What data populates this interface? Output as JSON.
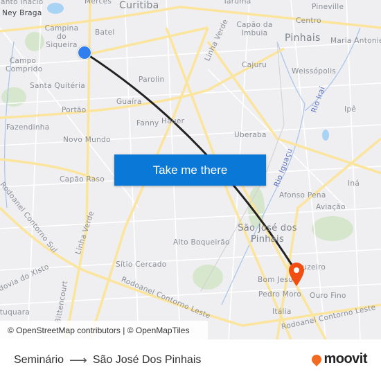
{
  "map": {
    "labels": {
      "santo_inacio": "Santo Inácio",
      "merces": "Mercês",
      "curitiba": "Curitiba",
      "taruma": "Tarumã",
      "pineville": "Pineville",
      "ney_braga": "Ney Braga",
      "campina_do_siqueira": "Campina do Siqueira",
      "batel": "Batel",
      "linha_verde_north": "Linha Verde",
      "capao_da_imbuia": "Capão da Imbuia",
      "centro": "Centro",
      "pinhais": "Pinhais",
      "maria_antonieta": "Maria Antonie",
      "campo_comprido": "Campo Comprido",
      "parolin": "Parolin",
      "cajuru": "Cajuru",
      "weissopolis": "Weissópolis",
      "santa_quiteria": "Santa Quitéria",
      "guaira": "Guaíra",
      "rio_irai": "Rio Iraí",
      "portao": "Portão",
      "ipe": "Ipê",
      "fazendinha": "Fazendinha",
      "fanny": "Fanny",
      "hauer": "Hauer",
      "uberaba": "Uberaba",
      "novo_mundo": "Novo Mundo",
      "rio_iguacu": "Rio Iguaçu",
      "capao_raso": "Capão Raso",
      "ina": "Iná",
      "afonso_pena": "Afonso Pena",
      "aviacao": "Aviação",
      "contorno_sul": "Rodoanel Contorno Sul",
      "linha_verde_south": "Linha Verde",
      "sao_jose_dos_pinhais": "São José dos Pinhais",
      "alto_boqueirao": "Alto Boqueirão",
      "sitio_cercado": "Sítio Cercado",
      "cruzeiro": "Cruzeiro",
      "rodovia_do_xisto": "Rodovia do Xisto",
      "bom_jesus": "Bom Jesus",
      "contorno_leste_west": "Rodoanel Contorno Leste",
      "pedro_moro": "Pedro Moro",
      "ouro_fino": "Ouro Fino",
      "bittencourt": "Bittencourt",
      "italia": "Itália",
      "contorno_leste_east": "Rodoanel Contorno Leste",
      "tatuquara": "Tatuquara"
    },
    "origin_marker_color": "#2f7ff0",
    "destination_marker_color": "#f04e12",
    "route_color": "#222222"
  },
  "cta": {
    "label": "Take me there",
    "color": "#0a78d7"
  },
  "attribution": "© OpenStreetMap contributors | © OpenMapTiles",
  "footer": {
    "from": "Seminário",
    "arrow": "⟶",
    "to": "São José Dos Pinhais",
    "logo": "moovit",
    "logo_color": "#f26b21"
  }
}
